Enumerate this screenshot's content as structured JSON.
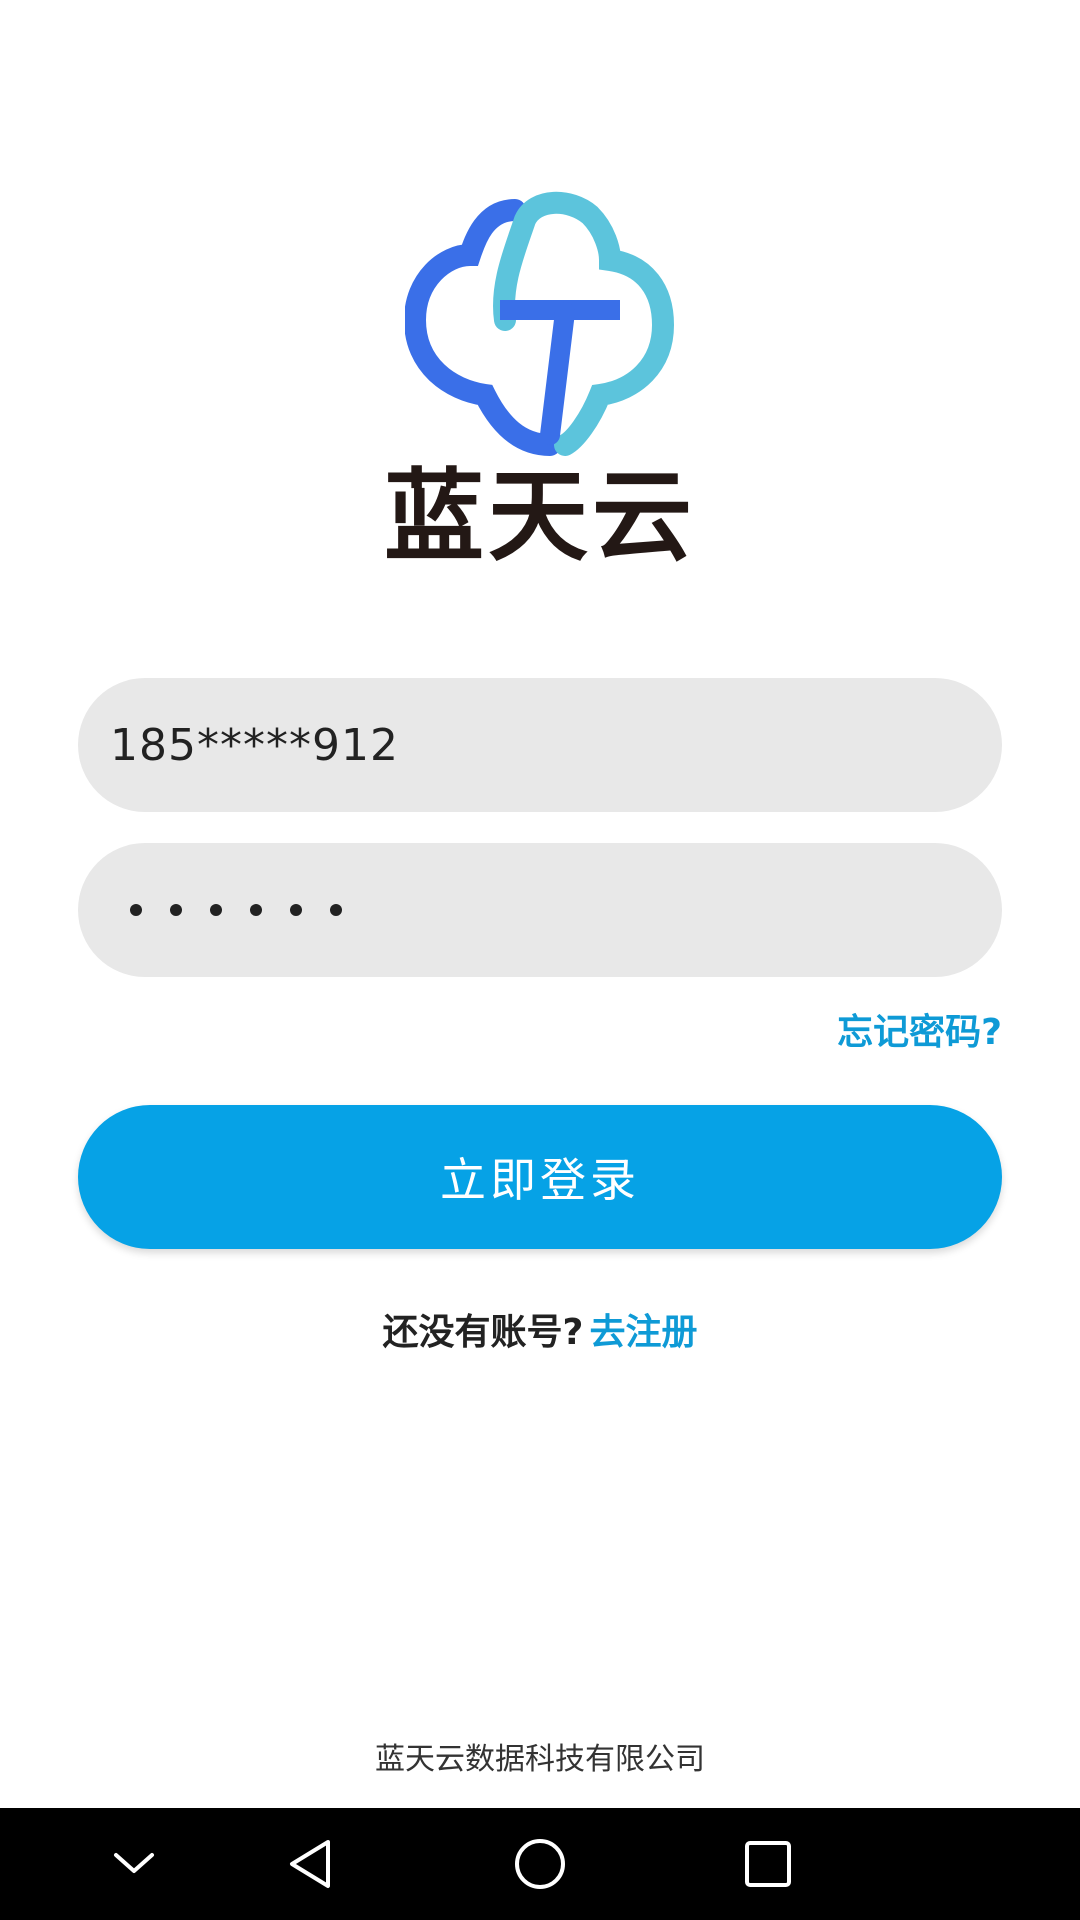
{
  "app": {
    "brand_name": "蓝天云",
    "logo_icon": "cloud-g-logo-icon",
    "colors": {
      "primary": "#06a2e6",
      "link": "#0e9ad6",
      "logo_dark_blue": "#3a6fe8",
      "logo_light_blue": "#5cc4dc",
      "field_background": "#e8e8e8"
    }
  },
  "login_form": {
    "phone_value": "185*****912",
    "password_masked_length": 6,
    "forgot_password_label": "忘记密码?",
    "login_button_label": "立即登录"
  },
  "register": {
    "prompt": "还没有账号?",
    "link_label": "去注册"
  },
  "footer": {
    "company": "蓝天云数据科技有限公司"
  },
  "nav_bar": {
    "buttons": [
      "chevron-down-icon",
      "back-triangle-icon",
      "home-circle-icon",
      "recents-square-icon"
    ]
  }
}
